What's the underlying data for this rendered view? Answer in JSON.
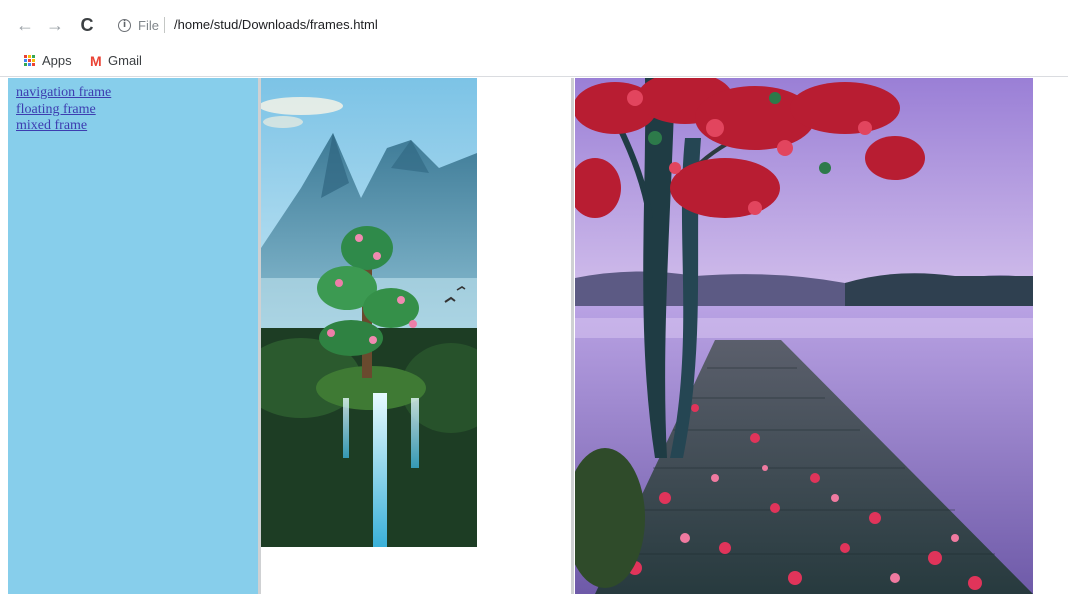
{
  "browser": {
    "url_scheme": "File",
    "url_path": "/home/stud/Downloads/frames.html",
    "bookmarks": [
      {
        "label": "Apps",
        "icon": "apps-grid-icon"
      },
      {
        "label": "Gmail",
        "icon": "gmail-icon"
      }
    ]
  },
  "nav_frame": {
    "links": [
      "navigation frame",
      "floating frame",
      "mixed frame"
    ],
    "background": "#87ceeb"
  },
  "images": {
    "floating": {
      "icon": "mountain-waterfall-tree-image"
    },
    "mixed": {
      "icon": "lake-pier-red-tree-image"
    }
  }
}
